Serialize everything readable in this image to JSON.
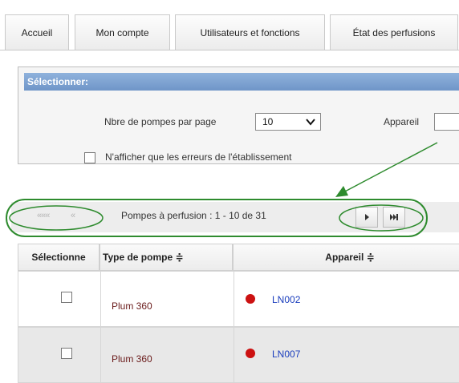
{
  "tabs": [
    {
      "label": "Accueil"
    },
    {
      "label": "Mon compte"
    },
    {
      "label": "Utilisateurs et fonctions"
    },
    {
      "label": "État des perfusions"
    }
  ],
  "filter_panel": {
    "header": "Sélectionner:",
    "pumps_per_page_label": "Nbre de pompes par page",
    "pumps_per_page_value": "10",
    "device_label": "Appareil",
    "device_value": "",
    "errors_only_label": "N'afficher que les erreurs de l'établissement",
    "errors_only_checked": false
  },
  "pager": {
    "first_label": "«««",
    "prev_label": "«",
    "summary": "Pompes à perfusion : 1 - 10 de 31",
    "next_icon": "next-page-icon",
    "last_icon": "last-page-icon"
  },
  "table": {
    "columns": [
      "Sélectionne",
      "Type de pompe ≑",
      "Appareil ≑"
    ],
    "rows": [
      {
        "selected": false,
        "pump_type": "Plum 360",
        "device": "LN002",
        "status_color": "#cc1111"
      },
      {
        "selected": false,
        "pump_type": "Plum 360",
        "device": "LN007",
        "status_color": "#cc1111"
      }
    ]
  },
  "annotation": {
    "color": "#2e8b2e"
  }
}
